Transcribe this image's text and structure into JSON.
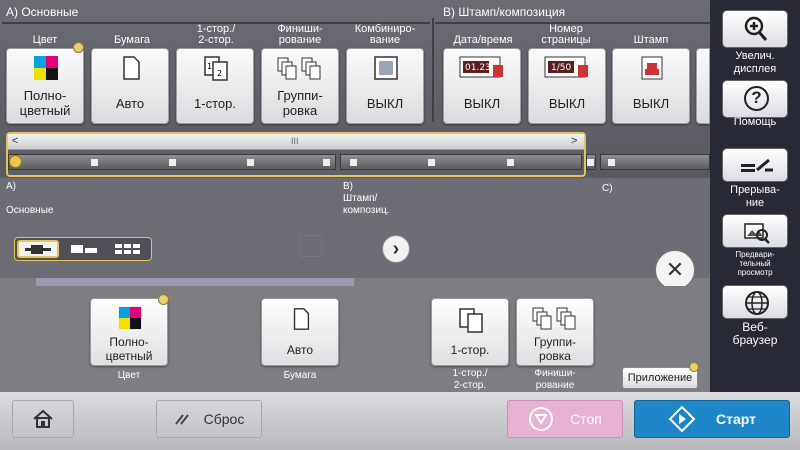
{
  "sections": {
    "a_title": "A)  Основные",
    "b_title": "B)  Штамп/композиция"
  },
  "top_buttons": [
    {
      "group": "Цвет",
      "label": "Полно-\nцветный",
      "icon": "color-squares-icon"
    },
    {
      "group": "Бумага",
      "label": "Авто",
      "icon": "paper-icon"
    },
    {
      "group": "1-стор./\n2-стор.",
      "label": "1-стор.",
      "icon": "duplex-icon"
    },
    {
      "group": "Финиши-\nрование",
      "label": "Группи-\nровка",
      "icon": "grouping-icon"
    },
    {
      "group": "Комбиниро-\nвание",
      "label": "ВЫКЛ",
      "icon": "combine-icon"
    },
    {
      "group": "Дата/время",
      "label": "ВЫКЛ",
      "icon": "date-time-icon",
      "icon_text": "01.23"
    },
    {
      "group": "Номер\nстраницы",
      "label": "ВЫКЛ",
      "icon": "page-number-icon",
      "icon_text": "1/50"
    },
    {
      "group": "Штамп",
      "label": "ВЫКЛ",
      "icon": "stamp-icon"
    }
  ],
  "slider": {
    "left_arrow": "<",
    "right_arrow": ">",
    "grip": "III",
    "label_a": "A)\n\nОсновные",
    "label_b": "B)\nШтамп/\nкомпозиц.",
    "label_c": "C)",
    "next_glyph": "›"
  },
  "view_modes": [
    "list-view-icon",
    "compact-view-icon",
    "grid-view-icon"
  ],
  "close_glyph": "✕",
  "right_panel": [
    {
      "label": "Увелич.\nдисплея",
      "icon": "zoom-in-icon"
    },
    {
      "label": "Помощь",
      "icon": "help-icon",
      "glyph": "?"
    },
    {
      "label": "Прерыва-\nние",
      "icon": "interrupt-icon"
    },
    {
      "label": "Предвари-\nтельный\nпросмотр",
      "icon": "preview-icon"
    },
    {
      "label": "Веб-\nбраузер",
      "icon": "globe-icon"
    }
  ],
  "bottom_buttons": [
    {
      "label": "Полно-\nцветный",
      "caption": "Цвет"
    },
    {
      "label": "Авто",
      "caption": "Бумага"
    },
    {
      "label": "1-стор.",
      "caption": "1-стор./\n2-стор."
    },
    {
      "label": "Группи-\nровка",
      "caption": "Финиши-\nрование"
    }
  ],
  "application_label": "Приложение",
  "bottom_bar": {
    "home_icon": "home-icon",
    "reset_label": "Сброс",
    "stop_label": "Стоп",
    "start_label": "Старт"
  },
  "colors": {
    "start": "#1f86c8",
    "stop": "#e7b1d2",
    "highlight": "#e2c65a"
  }
}
